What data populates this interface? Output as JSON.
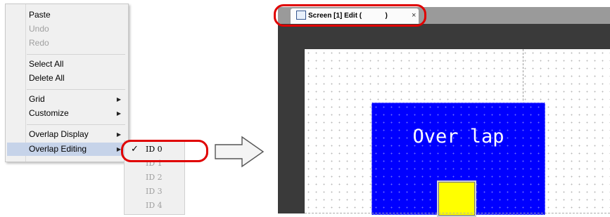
{
  "context_menu": {
    "groups": [
      [
        {
          "label": "Paste",
          "enabled": true
        },
        {
          "label": "Undo",
          "enabled": false
        },
        {
          "label": "Redo",
          "enabled": false
        }
      ],
      [
        {
          "label": "Select All",
          "enabled": true
        },
        {
          "label": "Delete All",
          "enabled": true
        }
      ],
      [
        {
          "label": "Grid",
          "enabled": true,
          "submenu": true
        },
        {
          "label": "Customize",
          "enabled": true,
          "submenu": true
        }
      ],
      [
        {
          "label": "Overlap Display",
          "enabled": true,
          "submenu": true
        },
        {
          "label": "Overlap Editing",
          "enabled": true,
          "submenu": true,
          "highlighted": true
        }
      ]
    ],
    "arrow_glyph": "▶"
  },
  "submenu": {
    "items": [
      {
        "label": "ID 0",
        "checked": true,
        "enabled": true
      },
      {
        "label": "ID 1",
        "enabled": false
      },
      {
        "label": "ID 2",
        "enabled": false
      },
      {
        "label": "ID 3",
        "enabled": false
      },
      {
        "label": "ID 4",
        "enabled": false
      }
    ],
    "check_glyph": "✓"
  },
  "editor": {
    "tab_label": "Screen [1] Edit (            )",
    "close_glyph": "×",
    "overlap_text": "Over lap"
  },
  "colors": {
    "highlight_ring": "#e00000",
    "overlap_fill": "#0000ff",
    "part_fill": "#ffff00"
  }
}
